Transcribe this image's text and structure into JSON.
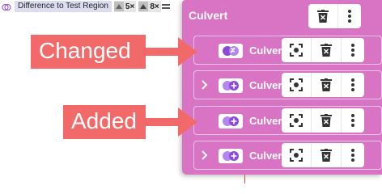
{
  "toolbar": {
    "region_label": "Difference to Test Region",
    "counts": [
      {
        "icon": "changed-items-icon",
        "value": "5×"
      },
      {
        "icon": "added-items-icon",
        "value": "8×"
      }
    ]
  },
  "panel": {
    "title": "Culvert",
    "rows": [
      {
        "label": "Culvert",
        "status": "changed",
        "expanded": false
      },
      {
        "label": "Culvert",
        "status": "added",
        "expanded": false
      },
      {
        "label": "Culvert",
        "status": "added",
        "expanded": false
      },
      {
        "label": "Culvert",
        "status": "added",
        "expanded": false
      }
    ]
  },
  "callouts": {
    "changed": "Changed",
    "added": "Added"
  },
  "colors": {
    "panel_bg": "#d974c4",
    "callout_bg": "#f2696a",
    "icon_purple": "#8b4ad8"
  }
}
